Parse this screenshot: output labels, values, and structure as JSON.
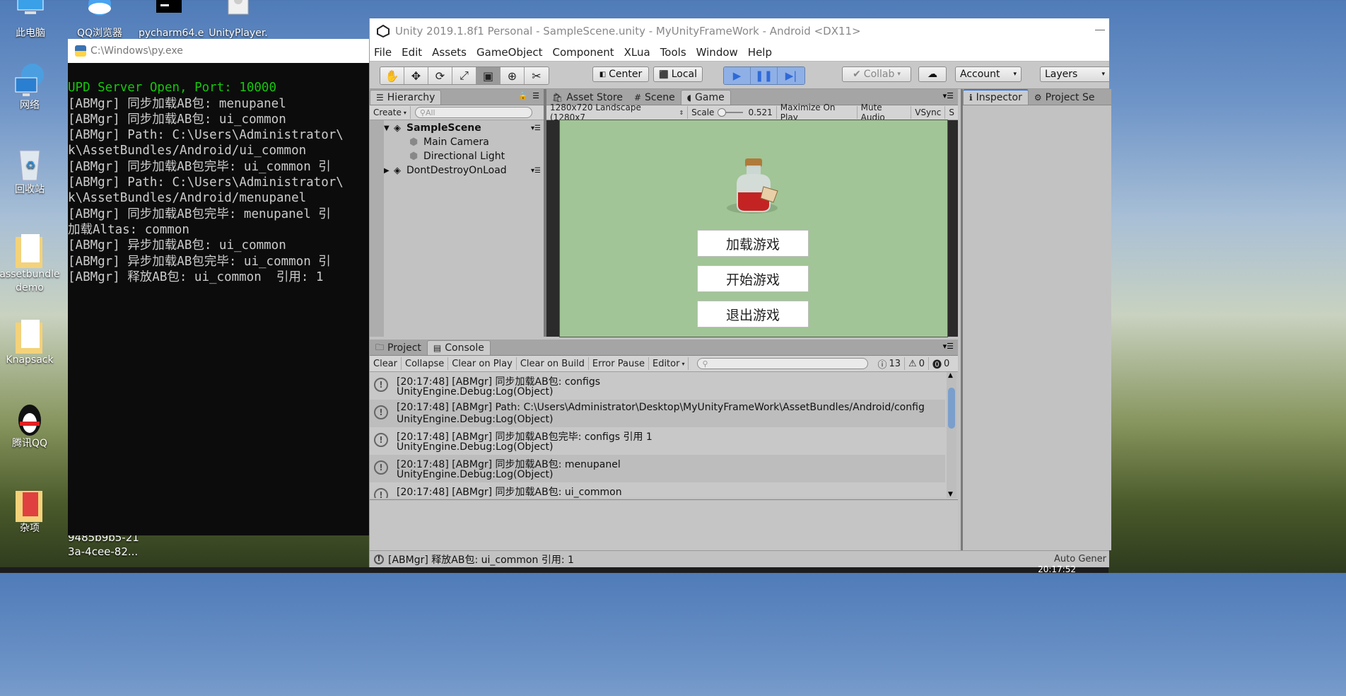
{
  "desktop": {
    "top_labels": [
      "此电脑",
      "QQ浏览器",
      "pycharm64.e",
      "UnityPlayer."
    ],
    "icons": [
      "网络",
      "回收站",
      "assetbundle demo",
      "Knapsack",
      "腾讯QQ",
      "杂项"
    ],
    "snippet": [
      "9485b9b5-21",
      "3a-4cee-82..."
    ]
  },
  "cmd": {
    "title": "C:\\Windows\\py.exe",
    "lines": [
      "UPD Server Open, Port: 10000",
      "[ABMgr] 同步加载AB包: menupanel",
      "[ABMgr] 同步加载AB包: ui_common",
      "[ABMgr] Path: C:\\Users\\Administrator\\",
      "k\\AssetBundles/Android/ui_common",
      "[ABMgr] 同步加载AB包完毕: ui_common 引",
      "[ABMgr] Path: C:\\Users\\Administrator\\",
      "k\\AssetBundles/Android/menupanel",
      "[ABMgr] 同步加载AB包完毕: menupanel 引",
      "加载Altas: common",
      "[ABMgr] 异步加载AB包: ui_common",
      "[ABMgr] 异步加载AB包完毕: ui_common 引",
      "[ABMgr] 释放AB包: ui_common  引用: 1"
    ]
  },
  "unity": {
    "title": "Unity 2019.1.8f1 Personal - SampleScene.unity - MyUnityFrameWork - Android <DX11>",
    "menu": [
      "File",
      "Edit",
      "Assets",
      "GameObject",
      "Component",
      "XLua",
      "Tools",
      "Window",
      "Help"
    ],
    "toolbar": {
      "center": "Center",
      "local": "Local",
      "collab": "Collab",
      "account": "Account",
      "layers": "Layers"
    },
    "hierarchy": {
      "tab": "Hierarchy",
      "create": "Create",
      "search_placeholder": "All",
      "scene": "SampleScene",
      "items": [
        "Main Camera",
        "Directional Light"
      ],
      "ddol": "DontDestroyOnLoad"
    },
    "center_tabs": [
      "Asset Store",
      "Scene",
      "Game"
    ],
    "game_toolbar": {
      "resolution": "1280x720 Landscape (1280x7",
      "scale_label": "Scale",
      "scale_value": "0.521",
      "maximize": "Maximize On Play",
      "mute": "Mute Audio",
      "vsync": "VSync",
      "stats": "S"
    },
    "game_buttons": [
      "加载游戏",
      "开始游戏",
      "退出游戏"
    ],
    "right_tabs": [
      "Inspector",
      "Project Se"
    ],
    "bottom_tabs": [
      "Project",
      "Console"
    ],
    "console_toolbar": {
      "clear": "Clear",
      "collapse": "Collapse",
      "clear_on_play": "Clear on Play",
      "clear_on_build": "Clear on Build",
      "error_pause": "Error Pause",
      "editor": "Editor",
      "log_count": "13",
      "warn_count": "0",
      "error_count": "0"
    },
    "console_rows": [
      {
        "line1": "[20:17:48] [ABMgr] 同步加载AB包: configs",
        "line2": "UnityEngine.Debug:Log(Object)"
      },
      {
        "line1": "[20:17:48] [ABMgr] Path: C:\\Users\\Administrator\\Desktop\\MyUnityFrameWork\\AssetBundles/Android/config",
        "line2": "UnityEngine.Debug:Log(Object)"
      },
      {
        "line1": "[20:17:48] [ABMgr] 同步加载AB包完毕: configs 引用 1",
        "line2": "UnityEngine.Debug:Log(Object)"
      },
      {
        "line1": "[20:17:48] [ABMgr] 同步加载AB包: menupanel",
        "line2": "UnityEngine.Debug:Log(Object)"
      },
      {
        "line1": "[20:17:48] [ABMgr] 同步加载AB包: ui_common",
        "line2": ""
      }
    ],
    "status_bar": "[ABMgr] 释放AB包: ui_common  引用: 1",
    "auto_generate": "Auto Gener"
  },
  "taskbar": {
    "clock": "20:17:52"
  }
}
